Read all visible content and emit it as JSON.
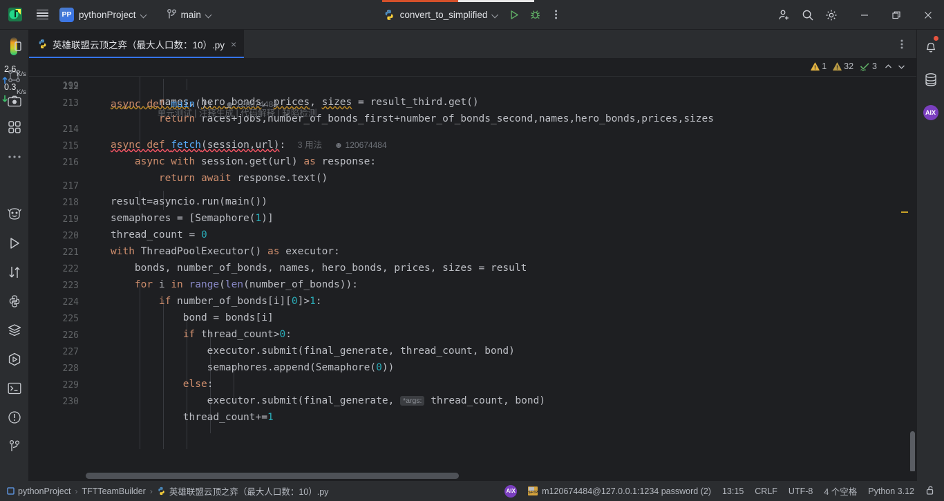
{
  "titlebar": {
    "app_logo": "pycharm-logo",
    "menu_icon": "hamburger-menu-icon",
    "project_badge": "PP",
    "project_name": "pythonProject",
    "branch_icon": "git-branch-icon",
    "branch_name": "main",
    "run_config": "convert_to_simplified",
    "run_icon": "run-icon",
    "debug_icon": "debug-icon",
    "more_icon": "more-vertical-icon",
    "account_icon": "add-account-icon",
    "search_icon": "search-icon",
    "settings_icon": "settings-gear-icon",
    "minimize": "minimize-icon",
    "maximize": "maximize-icon",
    "close": "close-icon"
  },
  "left_rail": {
    "network_up": "2.6",
    "network_up_unit": "K/s",
    "network_down": "0.3",
    "network_down_unit": "K/s",
    "items": [
      {
        "name": "project-tool-icon"
      },
      {
        "name": "commit-tool-icon"
      },
      {
        "name": "screenshot-icon"
      },
      {
        "name": "structure-icon"
      },
      {
        "name": "more-tools-icon"
      },
      {
        "name": "ai-assistant-icon"
      },
      {
        "name": "run-tool-icon"
      },
      {
        "name": "git-push-pull-icon"
      },
      {
        "name": "python-console-icon"
      },
      {
        "name": "services-icon"
      },
      {
        "name": "run-anything-icon"
      },
      {
        "name": "terminal-icon"
      },
      {
        "name": "problems-icon"
      },
      {
        "name": "version-control-icon"
      }
    ]
  },
  "right_rail": {
    "notifications_icon": "notification-bell-icon",
    "database_icon": "database-icon",
    "aix_icon": "aix-assistant-icon"
  },
  "tabs": [
    {
      "icon": "python-file-icon",
      "label": "英雄联盟云顶之弈（最大人口数：10）.py",
      "close": "×",
      "active": true
    }
  ],
  "tabbar": {
    "options_icon": "tab-options-icon"
  },
  "sticky_header": {
    "line_number": "199",
    "code": "async def main():",
    "author": "120674484"
  },
  "inspection_widget": {
    "warning_count": "1",
    "weak_warning_count": "32",
    "check_count": "3",
    "prev_icon": "chevron-up-icon",
    "next_icon": "chevron-down-icon"
  },
  "code_vision": {
    "actions": "单元测试 | 注释生成 | 代码解释 | 缺陷检测",
    "usages": "3 用法",
    "author": "120674484"
  },
  "editor": {
    "lines": [
      {
        "n": "212",
        "text": "        names, hero_bonds, prices, sizes = result_third.get()"
      },
      {
        "n": "213",
        "text": "        return races+jobs,number_of_bonds_first+number_of_bonds_second,names,hero_bonds,prices,sizes"
      },
      {
        "n": "214",
        "text": "async def fetch(session,url):"
      },
      {
        "n": "215",
        "text": "    async with session.get(url) as response:"
      },
      {
        "n": "216",
        "text": "        return await response.text()"
      },
      {
        "n": "217",
        "text": "result=asyncio.run(main())"
      },
      {
        "n": "218",
        "text": "semaphores = [Semaphore(1)]"
      },
      {
        "n": "219",
        "text": "thread_count = 0"
      },
      {
        "n": "220",
        "text": "with ThreadPoolExecutor() as executor:"
      },
      {
        "n": "221",
        "text": "    bonds, number_of_bonds, names, hero_bonds, prices, sizes = result"
      },
      {
        "n": "222",
        "text": "    for i in range(len(number_of_bonds)):"
      },
      {
        "n": "223",
        "text": "        if number_of_bonds[i][0]>1:"
      },
      {
        "n": "224",
        "text": "            bond = bonds[i]"
      },
      {
        "n": "225",
        "text": "            if thread_count>0:"
      },
      {
        "n": "226",
        "text": "                executor.submit(final_generate, thread_count, bond)"
      },
      {
        "n": "227",
        "text": "                semaphores.append(Semaphore(0))"
      },
      {
        "n": "228",
        "text": "            else:"
      },
      {
        "n": "229",
        "text": "                executor.submit(final_generate, *args: thread_count, bond)"
      },
      {
        "n": "230",
        "text": "            thread_count+=1"
      }
    ],
    "param_hint": "*args:"
  },
  "statusbar": {
    "breadcrumb": [
      {
        "label": "pythonProject",
        "icon": "project-folder-icon"
      },
      {
        "label": "TFTTeamBuilder",
        "icon": ""
      },
      {
        "label": "英雄联盟云顶之弈（最大人口数：10）.py",
        "icon": "python-file-icon"
      }
    ],
    "aix_label": "AIX",
    "sftp": "m120674484@127.0.0.1:1234 password (2)",
    "time": "13:15",
    "line_separator": "CRLF",
    "encoding": "UTF-8",
    "indent": "4 个空格",
    "interpreter": "Python 3.12",
    "lock_icon": "unlocked-padlock-icon"
  },
  "colors": {
    "background": "#1e1f22",
    "chrome": "#2b2d30",
    "accent": "#3574f0",
    "keyword": "#cf8e6d",
    "function": "#56a8f5",
    "number": "#2aacb8",
    "identifier": "#bcbec4",
    "warning": "#c9a227",
    "error": "#f75464",
    "success": "#5fad65"
  }
}
